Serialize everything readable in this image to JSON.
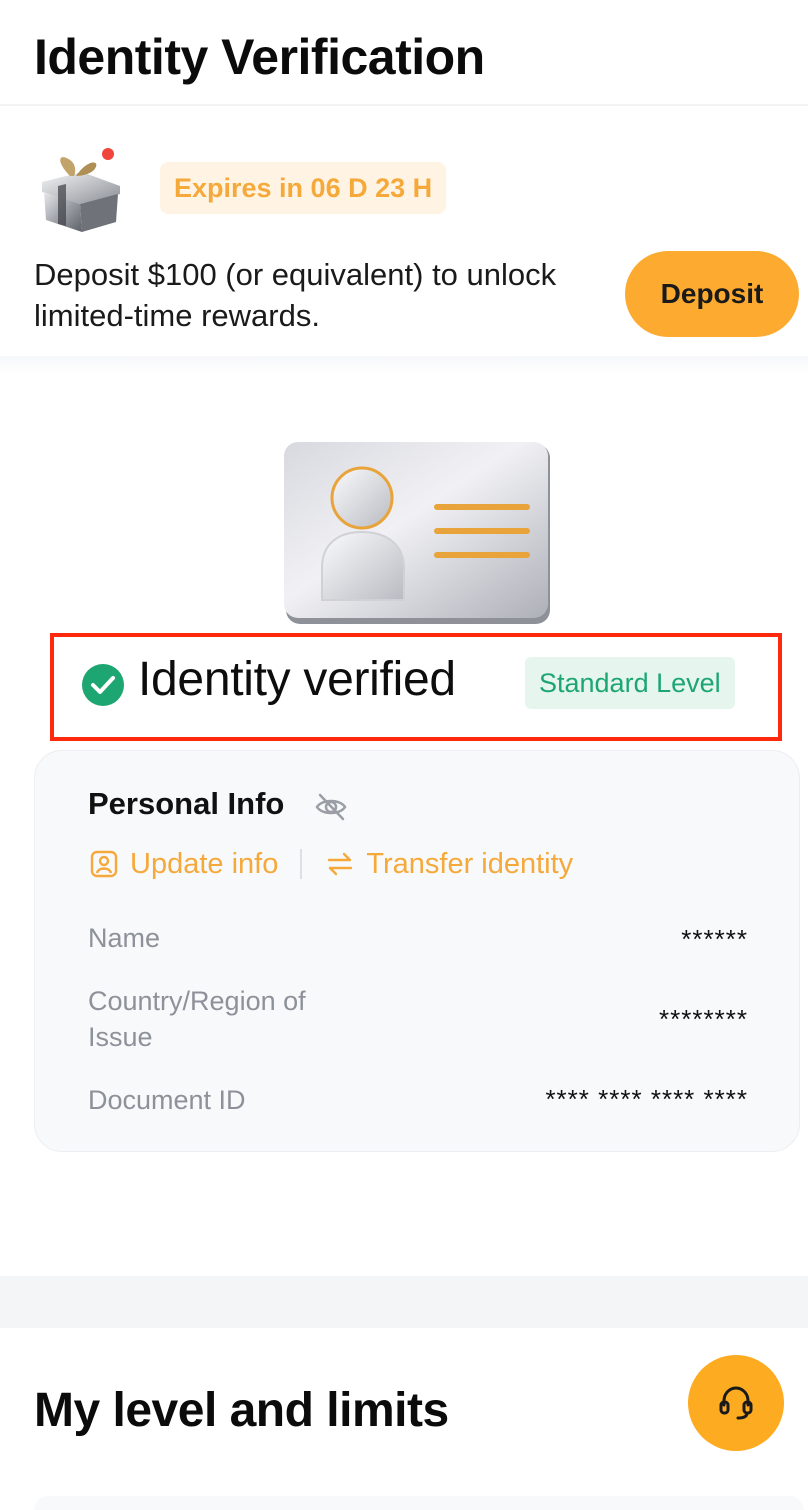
{
  "header": {
    "title": "Identity Verification"
  },
  "promo": {
    "expires": "Expires in 06 D 23 H",
    "text": "Deposit $100 (or equivalent) to unlock limited-time rewards.",
    "deposit_label": "Deposit",
    "icon": "gift-icon"
  },
  "status": {
    "verified_text": "Identity verified",
    "level_badge": "Standard Level",
    "icon": "check-circle-icon",
    "accent_color": "#1ea672"
  },
  "personal_info": {
    "title": "Personal Info",
    "actions": [
      {
        "label": "Update info",
        "icon": "profile-card-icon"
      },
      {
        "label": "Transfer identity",
        "icon": "swap-arrows-icon"
      }
    ],
    "rows": [
      {
        "label": "Name",
        "value": "******"
      },
      {
        "label": "Country/Region of Issue",
        "value": "********"
      },
      {
        "label": "Document ID",
        "value": "**** **** **** ****"
      }
    ]
  },
  "limits": {
    "title": "My level and limits"
  },
  "support": {
    "icon": "headset-icon"
  },
  "colors": {
    "brand": "#fdab30",
    "highlight": "#ff2a0e"
  }
}
